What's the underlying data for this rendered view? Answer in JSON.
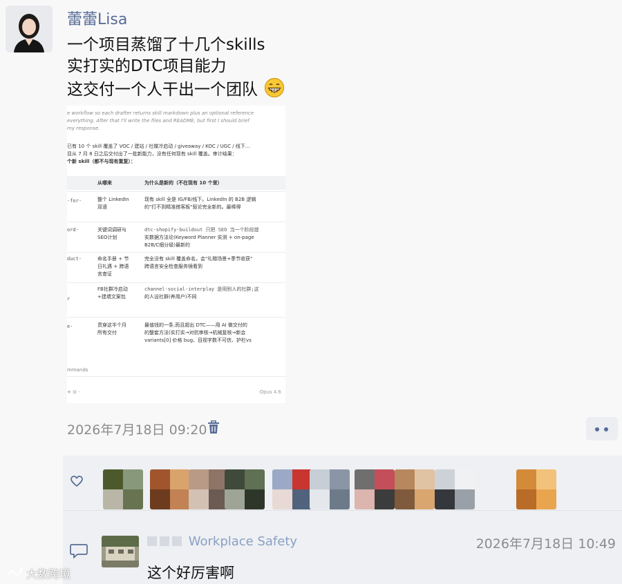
{
  "post": {
    "author": "蕾蕾Lisa",
    "lines": [
      "一个项目蒸馏了十几个skills",
      "实打实的DTC项目能力",
      "这交付一个人干出一个团队"
    ],
    "emoji": "grinning-face",
    "timestamp": "2026年7月18日 09:20"
  },
  "screenshot": {
    "prose_italic": [
      "e workflow so each drafter returns skill markdown plus an optional reference",
      "everything. After that I'll write the files and README, but first I should brief",
      "my response."
    ],
    "prose": [
      "已有 10 个 skill 覆盖了 VOC / 建站 / 社媒冷启动 / giveaway / KOC / UGC / 线下...",
      "目从 7 月 8 日之后交付出了一批新能力，没有任何现有 skill 覆盖。审计结果：",
      "个新 skill（都不与现有重复）："
    ],
    "table_headers": [
      "从哪来",
      "为什么是新的（不在现有 10 个里）"
    ],
    "rows": [
      {
        "key": "-for-",
        "source": [
          "整个 LinkedIn",
          "双语"
        ],
        "reason": [
          "现有 skill 全是 IG/FB/线下。LinkedIn 的 B2B 逻辑",
          "的\"打不到精准搭客板\"驱论完全新的。最棒得"
        ]
      },
      {
        "key": "ord-",
        "source": [
          "关键词调研与",
          "SEO计划"
        ],
        "reason": [
          "dtc-shopify-buildout 只把 SEO 当一个阶段提",
          "实数据方法论(Keyword Planner 实测 + on-page",
          "B2B/C细分级)最新的"
        ]
      },
      {
        "key": "duct-",
        "source": [
          "命名手册 + 节",
          "日礼遇 + 跨语",
          "言查证"
        ],
        "reason": [
          "完全没有 skill 覆盖命名。会\"礼赠场景+季节收获\"",
          "跨语言安全检查服务镜看到"
        ]
      },
      {
        "key": "r",
        "source": [
          "FB社群冷启动",
          "+建墙文案包"
        ],
        "reason": [
          "channel-social-interplay 是用别人的社群;这",
          "的人设社群(养用户)不同"
        ]
      },
      {
        "key": "e-",
        "source": [
          "贯穿这半个月",
          "所有交付"
        ],
        "reason": [
          "最值钱的一条,而且超出 DTC——用 AI 做交付的",
          "的整套方法(实打实→对抗审核→机械复核→新会",
          "variants[0] 价格 bug、目视字数不可信、护栏vs"
        ]
      }
    ],
    "commands_label": "mmands",
    "toolbar_text": "+   ⊙  ·",
    "model_label": "Opus 4.6"
  },
  "likes": {
    "liker_colors": [
      [
        "#4c5a2b",
        "#87997a",
        "#b9b6a8",
        "#687451"
      ],
      [
        "#a0552d",
        "#d9a36c",
        "#6d3b1e",
        "#c28254"
      ],
      [
        "#b89a86",
        "#8e7466",
        "#d3c1b3",
        "#6b5b52"
      ],
      [
        "#3f4a3a",
        "#5f7055",
        "#9fa596",
        "#2e3629"
      ],
      [
        "#9ba9c6",
        "#c9362f",
        "#e8d9d4",
        "#51627d"
      ],
      [
        "#c7ced6",
        "#8a96a5",
        "#e4e7eb",
        "#6d7a8a"
      ],
      [
        "#6f6f6f",
        "#c44f5a",
        "#dcb5ae",
        "#3c3c3c"
      ],
      [
        "#b8875e",
        "#e0c3a2",
        "#7f5a3c",
        "#d9a66f"
      ],
      [
        "#cdd2d8",
        "#f0f1f3",
        "#34383d",
        "#9aa0a8"
      ],
      [
        "#d38b3a",
        "#f2c27a",
        "#b96b28",
        "#e8a54e"
      ]
    ]
  },
  "comment": {
    "name_suffix": "Workplace Safety",
    "timestamp": "2026年7月18日 10:49",
    "text": "这个好厉害啊"
  },
  "watermark": "大数跨境"
}
